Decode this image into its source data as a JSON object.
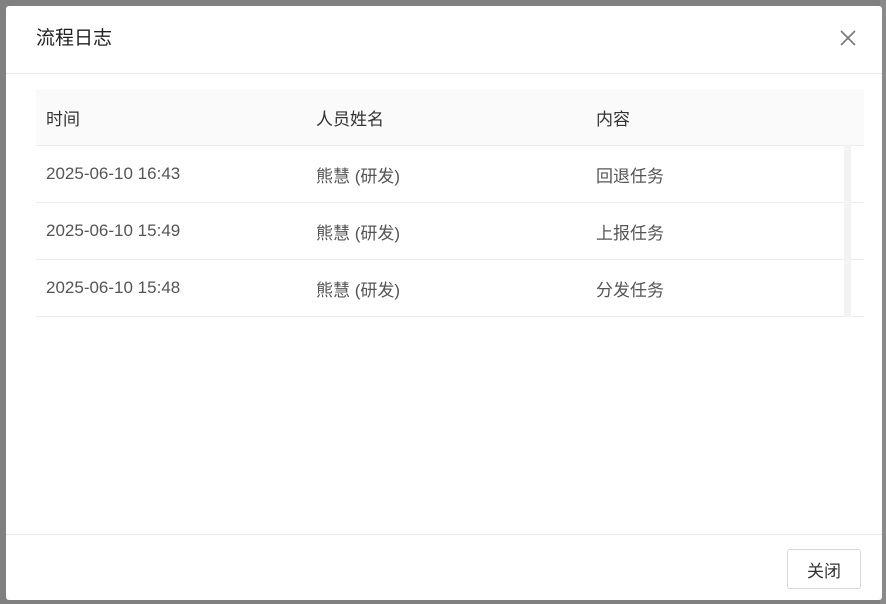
{
  "modal": {
    "title": "流程日志",
    "close_icon": "close-icon"
  },
  "table": {
    "columns": [
      "时间",
      "人员姓名",
      "内容"
    ],
    "rows": [
      {
        "time": "2025-06-10 16:43",
        "person": "熊慧 (研发)",
        "content": "回退任务"
      },
      {
        "time": "2025-06-10 15:49",
        "person": "熊慧 (研发)",
        "content": "上报任务"
      },
      {
        "time": "2025-06-10 15:48",
        "person": "熊慧 (研发)",
        "content": "分发任务"
      }
    ]
  },
  "footer": {
    "close_label": "关闭"
  }
}
